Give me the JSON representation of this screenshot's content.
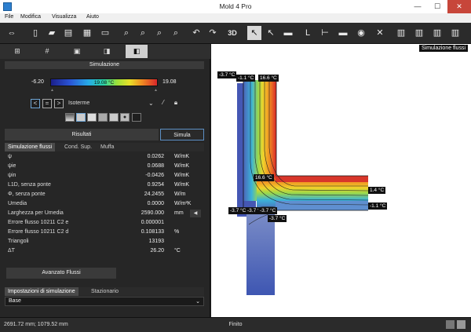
{
  "window": {
    "title": "Mold 4 Pro"
  },
  "menu": {
    "items": [
      "File",
      "Modifica",
      "Visualizza",
      "Aiuto"
    ]
  },
  "toolbar": {
    "view3d_label": "3D"
  },
  "panel": {
    "section_title": "Simulazione",
    "scale": {
      "min": "-6.20",
      "mid": "19.08 °C",
      "max": "19.08"
    },
    "nav": {
      "prev": "<",
      "eq": "=",
      "next": ">",
      "mode": "Isoterme"
    },
    "results_tab": "Risultati",
    "simulate_button": "Simula",
    "subtabs": [
      "Simulazione flussi",
      "Cond. Sup.",
      "Muffa"
    ],
    "rows": [
      {
        "label": "ψ",
        "value": "0.0262",
        "unit": "W/mK"
      },
      {
        "label": "ψie",
        "value": "0.0688",
        "unit": "W/mK"
      },
      {
        "label": "ψin",
        "value": "-0.0426",
        "unit": "W/mK"
      },
      {
        "label": "L1D, senza ponte",
        "value": "0.9254",
        "unit": "W/mK"
      },
      {
        "label": "Φ, senza ponte",
        "value": "24.2455",
        "unit": "W/m"
      },
      {
        "label": "Umedia",
        "value": "0.0000",
        "unit": "W/m²K"
      },
      {
        "label": "Larghezza per Umedia",
        "value": "2590.000",
        "unit": "mm"
      },
      {
        "label": "Errore flusso 10211 C2 e",
        "value": "0.000001",
        "unit": ""
      },
      {
        "label": "Errore flusso 10211 C2 d",
        "value": "0.108133",
        "unit": "%"
      },
      {
        "label": "Triangoli",
        "value": "13193",
        "unit": ""
      },
      {
        "label": "ΔT",
        "value": "26.20",
        "unit": "°C"
      }
    ],
    "advanced_button": "Avanzato Flussi",
    "bottom_tabs": [
      "Impostazioni di simulazione",
      "Stazionario"
    ],
    "base_select": "Base"
  },
  "canvas": {
    "title": "Simulazione flussi",
    "labels": [
      "-3.7 °C",
      "-1.1 °C",
      "16.6 °C",
      "16.6 °C",
      "1.4 °C",
      "-1.1 °C",
      "-3.7 °C",
      "-3.7 °C",
      "-3.7 °C",
      "-3.7 °C"
    ]
  },
  "status": {
    "coords": "2691.72 mm; 1079.52 mm",
    "state": "Finito"
  },
  "colors": {
    "accent": "#5c8fc4",
    "close": "#c7463a"
  }
}
